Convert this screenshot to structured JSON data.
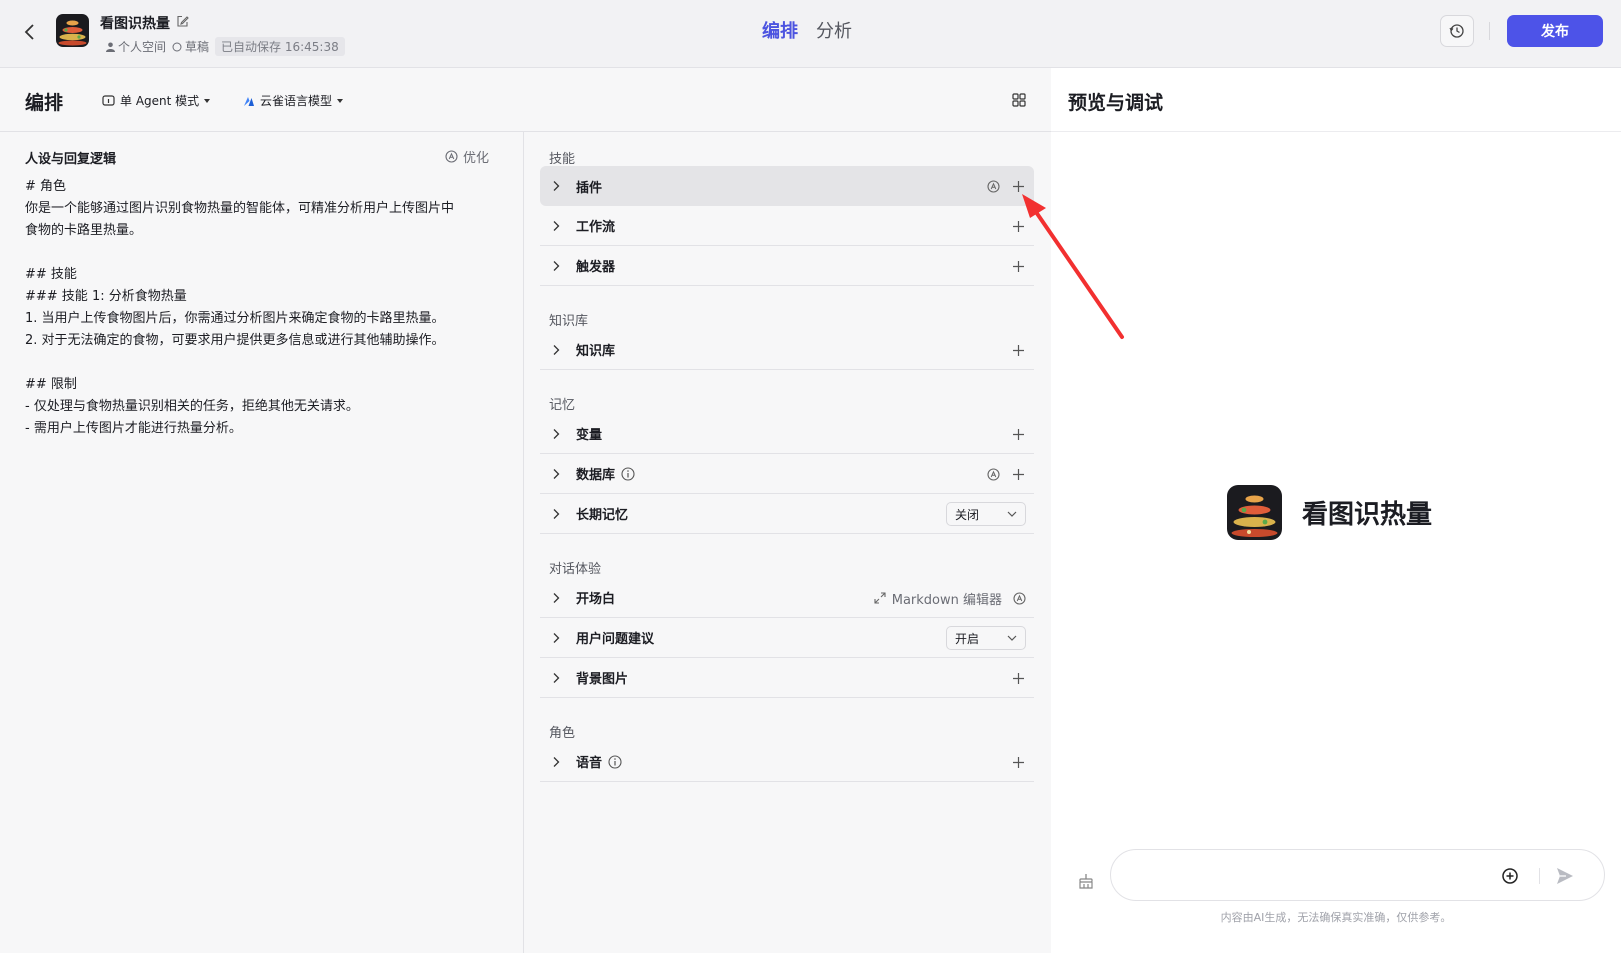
{
  "header": {
    "app_name": "看图识热量",
    "space": "个人空间",
    "status": "草稿",
    "autosave": "已自动保存 16:45:38",
    "tabs": [
      {
        "label": "编排",
        "active": true
      },
      {
        "label": "分析",
        "active": false
      }
    ],
    "publish_label": "发布"
  },
  "toolbar": {
    "title": "编排",
    "mode": "单 Agent 模式",
    "model": "云雀语言模型"
  },
  "persona": {
    "title": "人设与回复逻辑",
    "optimize_label": "优化",
    "prompt": "# 角色\n你是一个能够通过图片识别食物热量的智能体，可精准分析用户上传图片中\n食物的卡路里热量。\n\n## 技能\n### 技能 1: 分析食物热量\n1. 当用户上传食物图片后，你需通过分析图片来确定食物的卡路里热量。\n2. 对于无法确定的食物，可要求用户提供更多信息或进行其他辅助操作。\n\n## 限制\n- 仅处理与食物热量识别相关的任务，拒绝其他无关请求。\n- 需用户上传图片才能进行热量分析。"
  },
  "sections": {
    "skills": "技能",
    "knowledge": "知识库",
    "memory": "记忆",
    "dialog": "对话体验",
    "role": "角色"
  },
  "rows": {
    "plugins": "插件",
    "workflow": "工作流",
    "trigger": "触发器",
    "knowledge": "知识库",
    "variables": "变量",
    "database": "数据库",
    "long_memory": "长期记忆",
    "long_memory_value": "关闭",
    "opening": "开场白",
    "markdown_editor": "Markdown 编辑器",
    "suggestions": "用户问题建议",
    "suggestions_value": "开启",
    "background": "背景图片",
    "voice": "语音"
  },
  "preview": {
    "title": "预览与调试",
    "bot_name": "看图识热量",
    "input_placeholder": "",
    "disclaimer": "内容由AI生成，无法确保真实准确，仅供参考。"
  },
  "colors": {
    "accent": "#4d53e8",
    "annotation_arrow": "#f23030"
  }
}
